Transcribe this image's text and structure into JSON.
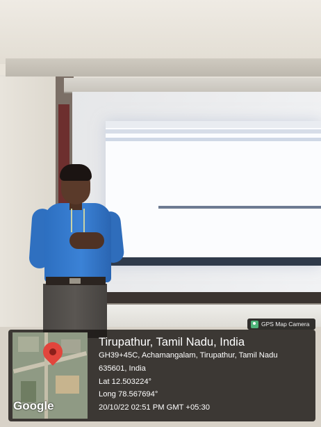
{
  "badge": {
    "label": "GPS Map Camera",
    "icon": "map-pin-app-icon"
  },
  "map": {
    "logo_text": "Google",
    "pin_color": "#e2453c"
  },
  "location": {
    "title": "Tirupathur, Tamil Nadu, India",
    "address_line1": "GH39+45C, Achamangalam, Tirupathur, Tamil Nadu",
    "address_line2": "635601, India",
    "latitude": "Lat 12.503224°",
    "longitude": "Long 78.567694°",
    "timestamp": "20/10/22 02:51 PM GMT +05:30"
  }
}
